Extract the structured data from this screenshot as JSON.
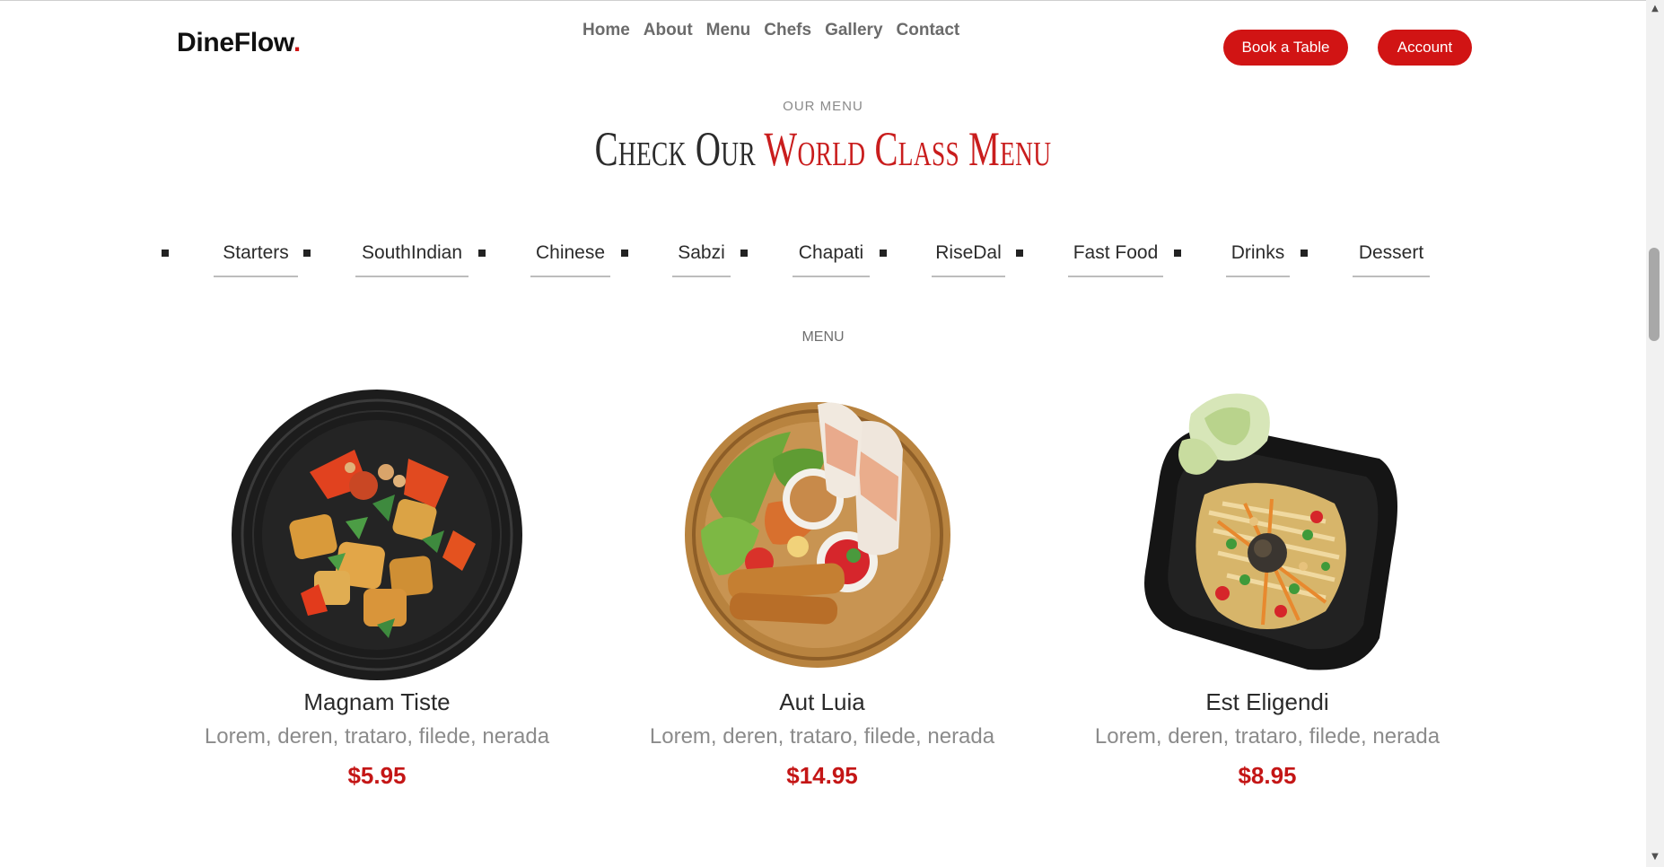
{
  "header": {
    "logo_text": "DineFlow",
    "logo_dot": ".",
    "nav": [
      "Home",
      "About",
      "Menu",
      "Chefs",
      "Gallery",
      "Contact"
    ],
    "book_button": "Book a Table",
    "account_button": "Account"
  },
  "menu_section": {
    "eyebrow": "OUR MENU",
    "title_plain": "Check Our",
    "title_accent": "World Class Menu",
    "categories": [
      "Starters",
      "SouthIndian",
      "Chinese",
      "Sabzi",
      "Chapati",
      "RiseDal",
      "Fast Food",
      "Drinks",
      "Dessert"
    ],
    "subheading": "MENU"
  },
  "items": [
    {
      "name": "Magnam Tiste",
      "description": "Lorem, deren, trataro, filede, nerada",
      "price": "$5.95"
    },
    {
      "name": "Aut Luia",
      "description": "Lorem, deren, trataro, filede, nerada",
      "price": "$14.95"
    },
    {
      "name": "Est Eligendi",
      "description": "Lorem, deren, trataro, filede, nerada",
      "price": "$8.95"
    }
  ],
  "colors": {
    "accent": "#d11414",
    "text_dark": "#2b2b2b",
    "text_muted": "#8b8b8b",
    "nav_text": "#6b6b6b"
  },
  "icons": {
    "scroll_up": "triangle-up-icon",
    "scroll_down": "triangle-down-icon",
    "category_bullet": "square-bullet-icon"
  }
}
